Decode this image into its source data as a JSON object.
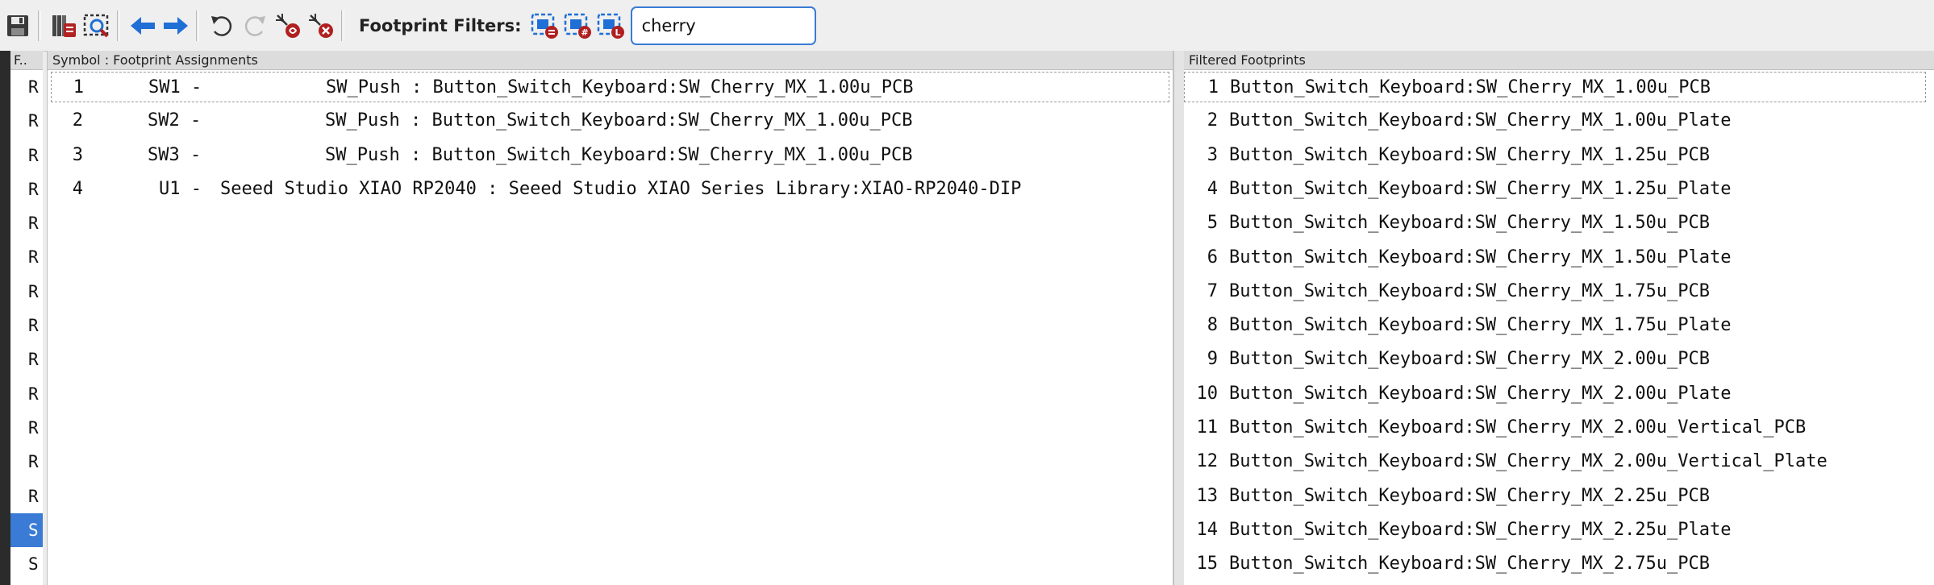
{
  "toolbar": {
    "buttons": [
      {
        "name": "save-icon",
        "color": "#333333"
      },
      {
        "name": "library-table-icon",
        "color": "#8b2a2a"
      },
      {
        "name": "view-footprint-icon",
        "color": "#1f6fd6"
      },
      {
        "name": "previous-arrow-icon",
        "color": "#1f6fd6"
      },
      {
        "name": "next-arrow-icon",
        "color": "#1f6fd6"
      },
      {
        "name": "undo-icon",
        "color": "#333333"
      },
      {
        "name": "redo-icon",
        "color": "#bbbbbb"
      },
      {
        "name": "auto-associate-icon",
        "color": "#b02020"
      },
      {
        "name": "delete-associations-icon",
        "color": "#b02020"
      }
    ],
    "filters_label": "Footprint Filters:",
    "filter_buttons": [
      "filter-by-keywords-icon",
      "filter-by-pin-count-icon",
      "filter-by-library-icon"
    ],
    "search_value": "cherry"
  },
  "libraries": {
    "header": "F..",
    "rows": [
      "R",
      "R",
      "R",
      "R",
      "R",
      "R",
      "R",
      "R",
      "R",
      "R",
      "R",
      "R",
      "R",
      "S",
      "S"
    ],
    "selected_index": 13
  },
  "assignments": {
    "header": "Symbol : Footprint Assignments",
    "rows": [
      {
        "num": "1",
        "ref": "SW1 -",
        "value": "SW_Push",
        "footprint": "Button_Switch_Keyboard:SW_Cherry_MX_1.00u_PCB"
      },
      {
        "num": "2",
        "ref": "SW2 -",
        "value": "SW_Push",
        "footprint": "Button_Switch_Keyboard:SW_Cherry_MX_1.00u_PCB"
      },
      {
        "num": "3",
        "ref": "SW3 -",
        "value": "SW_Push",
        "footprint": "Button_Switch_Keyboard:SW_Cherry_MX_1.00u_PCB"
      },
      {
        "num": "4",
        "ref": "U1 -",
        "value": "Seeed Studio XIAO RP2040",
        "footprint": "Seeed Studio XIAO Series Library:XIAO-RP2040-DIP"
      }
    ]
  },
  "filtered": {
    "header": "Filtered Footprints",
    "rows": [
      {
        "num": "1",
        "name": "Button_Switch_Keyboard:SW_Cherry_MX_1.00u_PCB"
      },
      {
        "num": "2",
        "name": "Button_Switch_Keyboard:SW_Cherry_MX_1.00u_Plate"
      },
      {
        "num": "3",
        "name": "Button_Switch_Keyboard:SW_Cherry_MX_1.25u_PCB"
      },
      {
        "num": "4",
        "name": "Button_Switch_Keyboard:SW_Cherry_MX_1.25u_Plate"
      },
      {
        "num": "5",
        "name": "Button_Switch_Keyboard:SW_Cherry_MX_1.50u_PCB"
      },
      {
        "num": "6",
        "name": "Button_Switch_Keyboard:SW_Cherry_MX_1.50u_Plate"
      },
      {
        "num": "7",
        "name": "Button_Switch_Keyboard:SW_Cherry_MX_1.75u_PCB"
      },
      {
        "num": "8",
        "name": "Button_Switch_Keyboard:SW_Cherry_MX_1.75u_Plate"
      },
      {
        "num": "9",
        "name": "Button_Switch_Keyboard:SW_Cherry_MX_2.00u_PCB"
      },
      {
        "num": "10",
        "name": "Button_Switch_Keyboard:SW_Cherry_MX_2.00u_Plate"
      },
      {
        "num": "11",
        "name": "Button_Switch_Keyboard:SW_Cherry_MX_2.00u_Vertical_PCB"
      },
      {
        "num": "12",
        "name": "Button_Switch_Keyboard:SW_Cherry_MX_2.00u_Vertical_Plate"
      },
      {
        "num": "13",
        "name": "Button_Switch_Keyboard:SW_Cherry_MX_2.25u_PCB"
      },
      {
        "num": "14",
        "name": "Button_Switch_Keyboard:SW_Cherry_MX_2.25u_Plate"
      },
      {
        "num": "15",
        "name": "Button_Switch_Keyboard:SW_Cherry_MX_2.75u_PCB"
      }
    ]
  },
  "colors": {
    "accent": "#3a7bd5",
    "selection": "#3a7bd5"
  }
}
